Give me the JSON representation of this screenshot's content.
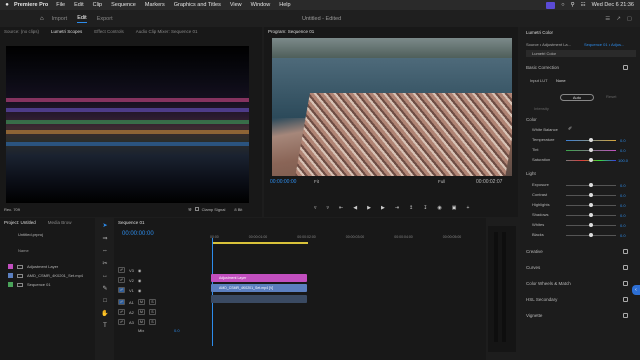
{
  "menubar": {
    "apple": "",
    "app_name": "Premiere Pro",
    "items": [
      "File",
      "Edit",
      "Clip",
      "Sequence",
      "Markers",
      "Graphics and Titles",
      "View",
      "Window",
      "Help"
    ],
    "datetime": "Wed Dec 6 21:36"
  },
  "workspace": {
    "tabs": [
      "Import",
      "Edit",
      "Export"
    ],
    "active_tab": "Edit",
    "title": "Untitled - Edited"
  },
  "source_panel": {
    "tabs": [
      "Source: (no clips)",
      "Lumetri Scopes",
      "Effect Controls",
      "Audio Clip Mixer: Sequence 01"
    ],
    "bottom_left": "Rec. 709",
    "clamp_label": "Clamp Signal",
    "bit_depth": "8 Bit"
  },
  "program": {
    "title": "Program: Sequence 01",
    "timecode_left": "00:00:00:00",
    "fit": "Fit",
    "quality": "Full",
    "timecode_right": "00:00:02:07"
  },
  "project": {
    "tabs": [
      "Project: Untitled",
      "Media Brow"
    ],
    "file": "Untitled.prproj",
    "col_name": "Name",
    "items": [
      {
        "name": "Adjustment Layer",
        "color": "#c24fbf"
      },
      {
        "name": "AMD_CSMR_4K0201_Set.mp4",
        "color": "#5b7fbf"
      },
      {
        "name": "Sequence 01",
        "color": "#4aa35a"
      }
    ]
  },
  "timeline": {
    "tab": "Sequence 01",
    "timecode": "00:00:00:00",
    "ruler": [
      "00:00",
      "00:00:01:00",
      "00:00:02:00",
      "00:00:03:00",
      "00:00:04:00",
      "00:00:05:00",
      "00:00:06:00"
    ],
    "video_tracks": [
      "V3",
      "V2",
      "V1"
    ],
    "audio_tracks": [
      "A1",
      "A2",
      "A3"
    ],
    "mix": "Mix",
    "mix_value": "0.0",
    "clips": [
      {
        "label": "Adjustment Layer",
        "color": "#c24fbf"
      },
      {
        "label": "AMD_CSMR_4K0201_Set.mp4 [V]",
        "color": "#5b7fbf"
      }
    ]
  },
  "lumetri": {
    "title": "Lumetri Color",
    "source": "Source • Adjustment La...",
    "seq": "Sequence 01 • Adjus...",
    "effect": "Lumetri Color",
    "basic": "Basic Correction",
    "input_lut_label": "Input LUT",
    "input_lut_value": "None",
    "auto": "Auto",
    "reset": "Reset",
    "intensity": "Intensity",
    "color": "Color",
    "white_balance": "White Balance",
    "sliders": [
      {
        "label": "Temperature",
        "value": "0.0"
      },
      {
        "label": "Tint",
        "value": "0.0"
      },
      {
        "label": "Saturation",
        "value": "100.0"
      }
    ],
    "light": "Light",
    "light_sliders": [
      {
        "label": "Exposure",
        "value": "0.0"
      },
      {
        "label": "Contrast",
        "value": "0.0"
      },
      {
        "label": "Highlights",
        "value": "0.0"
      },
      {
        "label": "Shadows",
        "value": "0.0"
      },
      {
        "label": "Whites",
        "value": "0.0"
      },
      {
        "label": "Blacks",
        "value": "0.0"
      }
    ],
    "sections": [
      "Creative",
      "Curves",
      "Color Wheels & Match",
      "HSL Secondary",
      "Vignette"
    ]
  },
  "colors": {
    "accent": "#2d8ceb",
    "adjust": "#c24fbf",
    "video": "#5b7fbf"
  }
}
